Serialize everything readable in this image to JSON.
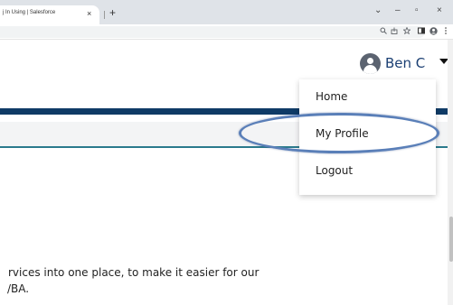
{
  "browser": {
    "tab_title": "j In Using | Salesforce",
    "tab_close": "×",
    "new_tab": "+",
    "window_controls": {
      "chevron": "⌄",
      "minimize": "–",
      "maximize": "▫",
      "close": "×"
    },
    "toolbar_icons": [
      "zoom-icon",
      "share-icon",
      "star-icon",
      "sidepanel-icon",
      "account-icon",
      "menu-icon"
    ]
  },
  "header": {
    "user_name": "Ben C"
  },
  "menu": {
    "items": [
      {
        "label": "Home"
      },
      {
        "label": "My Profile"
      },
      {
        "label": "Logout"
      }
    ]
  },
  "content": {
    "line1": "rvices into one place, to make it easier for our",
    "line2": "/BA."
  },
  "colors": {
    "navy": "#0f3b66",
    "teal": "#2b7a8c",
    "highlight": "#5a7fb8",
    "name_text": "#1b3f73"
  }
}
